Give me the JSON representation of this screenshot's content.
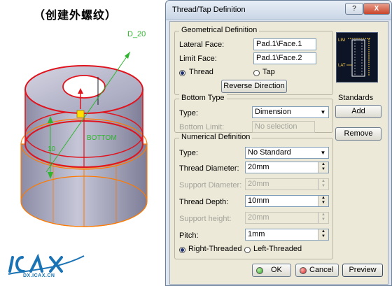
{
  "annotation": {
    "heading": "（创建外螺纹）",
    "dim_diameter": "D_20",
    "dim_height": "10",
    "bottom_label": "BOTTOM",
    "logo_sub": "DX.ICAX.CN"
  },
  "dialog": {
    "title": "Thread/Tap Definition",
    "help_label": "?",
    "close_label": "X",
    "geometrical": {
      "title": "Geometrical Definition",
      "lateral_face_label": "Lateral Face:",
      "lateral_face_value": "Pad.1\\Face.1",
      "limit_face_label": "Limit Face:",
      "limit_face_value": "Pad.1\\Face.2",
      "thread_label": "Thread",
      "tap_label": "Tap",
      "reverse_label": "Reverse Direction",
      "preview_lim": "LIM",
      "preview_lat": "LAT"
    },
    "bottom": {
      "title": "Bottom Type",
      "type_label": "Type:",
      "type_value": "Dimension",
      "limit_label": "Bottom Limit:",
      "limit_value": "No selection"
    },
    "standards": {
      "title": "Standards",
      "add_label": "Add",
      "remove_label": "Remove"
    },
    "numerical": {
      "title": "Numerical Definition",
      "type_label": "Type:",
      "type_value": "No Standard",
      "thread_diameter_label": "Thread Diameter:",
      "thread_diameter_value": "20mm",
      "support_diameter_label": "Support Diameter:",
      "support_diameter_value": "20mm",
      "thread_depth_label": "Thread Depth:",
      "thread_depth_value": "10mm",
      "support_height_label": "Support height:",
      "support_height_value": "20mm",
      "pitch_label": "Pitch:",
      "pitch_value": "1mm",
      "right_threaded_label": "Right-Threaded",
      "left_threaded_label": "Left-Threaded"
    },
    "footer": {
      "ok_label": "OK",
      "cancel_label": "Cancel",
      "preview_label": "Preview"
    }
  },
  "colors": {
    "model_body": "#9a9ab4",
    "model_edge": "#ff7a00",
    "thread_red": "#e0141e",
    "dim_green": "#2fb52f",
    "ok_green": "#2fa52f",
    "cancel_red": "#d8202a"
  }
}
